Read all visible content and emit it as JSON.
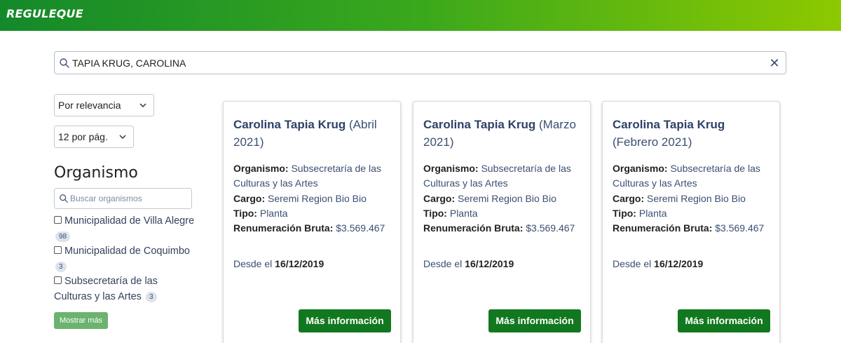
{
  "brand": {
    "logo": "REGULEQUE"
  },
  "search": {
    "value": "TAPIA KRUG, CAROLINA"
  },
  "sort": {
    "selected": "Por relevancia"
  },
  "per_page": {
    "selected": "12 por pág."
  },
  "organismo": {
    "title": "Organismo",
    "search_placeholder": "Buscar organismos",
    "items": [
      {
        "label": "Municipalidad de Villa Alegre",
        "count": "98"
      },
      {
        "label": "Municipalidad de Coquimbo",
        "count": "3"
      },
      {
        "label": "Subsecretaría de las Culturas y las Artes",
        "count": "3"
      }
    ],
    "more_label": "Mostrar más"
  },
  "labels": {
    "organismo": "Organismo:",
    "cargo": "Cargo:",
    "tipo": "Tipo:",
    "renumeracion": "Renumeración Bruta:",
    "desde": "Desde el",
    "more_info": "Más información"
  },
  "results": [
    {
      "name": "Carolina Tapia Krug",
      "period": "(Abril 2021)",
      "organismo": "Subsecretaría de las Culturas y las Artes",
      "cargo": "Seremi Region Bio Bio",
      "tipo": "Planta",
      "renumeracion": "$3.569.467",
      "desde": "16/12/2019"
    },
    {
      "name": "Carolina Tapia Krug",
      "period": "(Marzo 2021)",
      "organismo": "Subsecretaría de las Culturas y las Artes",
      "cargo": "Seremi Region Bio Bio",
      "tipo": "Planta",
      "renumeracion": "$3.569.467",
      "desde": "16/12/2019"
    },
    {
      "name": "Carolina Tapia Krug",
      "period": "(Febrero 2021)",
      "organismo": "Subsecretaría de las Culturas y las Artes",
      "cargo": "Seremi Region Bio Bio",
      "tipo": "Planta",
      "renumeracion": "$3.569.467",
      "desde": "16/12/2019"
    }
  ]
}
